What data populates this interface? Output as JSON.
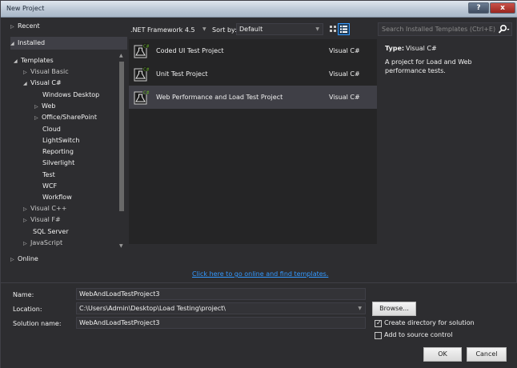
{
  "window": {
    "title": "New Project",
    "help_label": "?",
    "close_label": "x"
  },
  "tree": {
    "recent": "Recent",
    "installed": "Installed",
    "templates": "Templates",
    "visual_basic": "Visual Basic",
    "visual_csharp": "Visual C#",
    "windows_desktop": "Windows Desktop",
    "web": "Web",
    "office_sharepoint": "Office/SharePoint",
    "cloud": "Cloud",
    "lightswitch": "LightSwitch",
    "reporting": "Reporting",
    "silverlight": "Silverlight",
    "test": "Test",
    "wcf": "WCF",
    "workflow": "Workflow",
    "visual_cpp": "Visual C++",
    "visual_fsharp": "Visual F#",
    "sql_server": "SQL Server",
    "javascript": "JavaScript",
    "online": "Online"
  },
  "toolbar": {
    "framework": ".NET Framework 4.5",
    "sort_label": "Sort by:",
    "sort_value": "Default"
  },
  "search": {
    "placeholder": "Search Installed Templates (Ctrl+E)"
  },
  "templates": [
    {
      "name": "Coded UI Test Project",
      "lang": "Visual C#"
    },
    {
      "name": "Unit Test Project",
      "lang": "Visual C#"
    },
    {
      "name": "Web Performance and Load Test Project",
      "lang": "Visual C#"
    }
  ],
  "online_link": "Click here to go online and find templates.",
  "details": {
    "type_label": "Type:",
    "type_value": "Visual C#",
    "description": "A project for Load and Web performance tests."
  },
  "form": {
    "name_label": "Name:",
    "name_value": "WebAndLoadTestProject3",
    "location_label": "Location:",
    "location_value": "C:\\Users\\Admin\\Desktop\\Load Testing\\project\\",
    "solution_label": "Solution name:",
    "solution_value": "WebAndLoadTestProject3",
    "browse": "Browse...",
    "create_dir": "Create directory for solution",
    "create_dir_checked": true,
    "source_control": "Add to source control",
    "source_control_checked": false,
    "ok": "OK",
    "cancel": "Cancel"
  },
  "colors": {
    "accent": "#3399ff",
    "selected_row": "#3f3f46",
    "background": "#2d2d30"
  }
}
